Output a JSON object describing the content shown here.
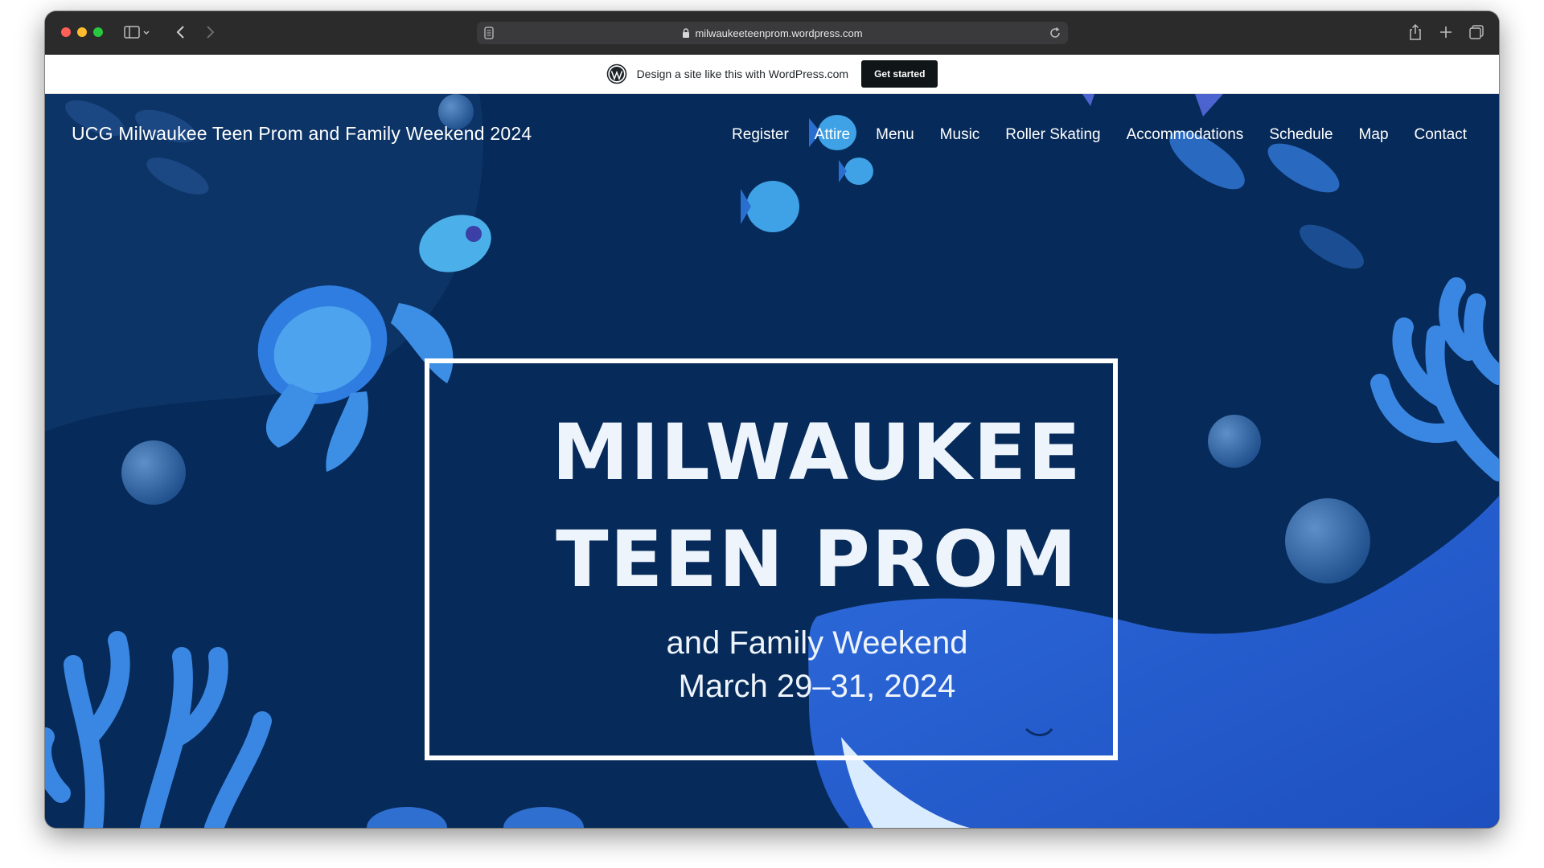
{
  "browser": {
    "url": "milwaukeeteenprom.wordpress.com"
  },
  "wp_banner": {
    "text": "Design a site like this with WordPress.com",
    "button": "Get started"
  },
  "site": {
    "title": "UCG Milwaukee Teen Prom and Family Weekend 2024",
    "nav": [
      "Register",
      "Attire",
      "Menu",
      "Music",
      "Roller Skating",
      "Accommodations",
      "Schedule",
      "Map",
      "Contact"
    ]
  },
  "hero": {
    "line1": "MILWAUKEE",
    "line2": "TEEN PROM",
    "sub1": "and Family Weekend",
    "sub2": "March 29–31, 2024"
  },
  "colors": {
    "background": "#062a59",
    "accent_blue": "#2f7de1",
    "text": "#ffffff"
  }
}
